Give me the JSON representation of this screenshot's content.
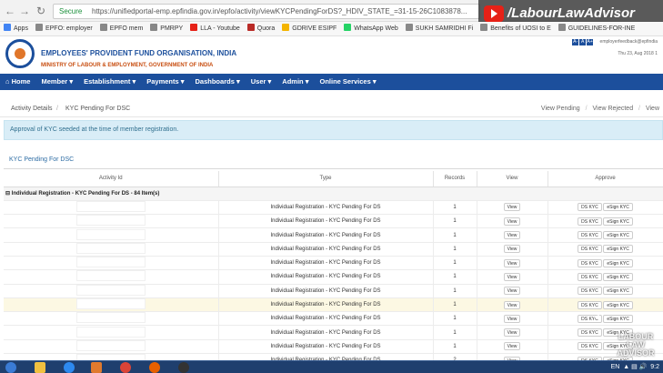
{
  "browser": {
    "secure_label": "Secure",
    "url": "https://unifiedportal-emp.epfindia.gov.in/epfo/activity/viewKYCPendingForDS?_HDIV_STATE_=31-15-26C1083878...",
    "bookmarks": [
      {
        "label": "Apps",
        "color": "#4285f4"
      },
      {
        "label": "EPFO: employer",
        "color": "#888888"
      },
      {
        "label": "EPFO mem",
        "color": "#888888"
      },
      {
        "label": "PMRPY",
        "color": "#888888"
      },
      {
        "label": "LLA - Youtube",
        "color": "#e62117"
      },
      {
        "label": "Quora",
        "color": "#b92b27"
      },
      {
        "label": "GDRIVE ESIPF",
        "color": "#f4b400"
      },
      {
        "label": "WhatsApp Web",
        "color": "#25d366"
      },
      {
        "label": "SUKH SAMRIDHI Fi",
        "color": "#888888"
      },
      {
        "label": "Benefits of UOSI to E",
        "color": "#888888"
      },
      {
        "label": "GUIDELINES-FOR-INE",
        "color": "#888888"
      }
    ]
  },
  "overlay": {
    "channel_title": "/LabourLawAdvisor",
    "watermark": "LABOUR LAW ADVISOR"
  },
  "header": {
    "org_name": "EMPLOYEES' PROVIDENT FUND ORGANISATION, INDIA",
    "ministry": "MINISTRY OF LABOUR & EMPLOYMENT, GOVERNMENT OF INDIA",
    "font_buttons": [
      "A-",
      "A",
      "A+"
    ],
    "feedback_email": "employerfeedback@epfindia",
    "date": "Thu 23, Aug 2018 1"
  },
  "nav": {
    "items": [
      "Home",
      "Member",
      "Establishment",
      "Payments",
      "Dashboards",
      "User",
      "Admin",
      "Online Services"
    ]
  },
  "breadcrumb": {
    "items": [
      "Activity Details",
      "KYC Pending For DSC"
    ],
    "actions": [
      "View Pending",
      "View Rejected",
      "View"
    ]
  },
  "alert": "Approval of KYC seeded at the time of member registration.",
  "panel_title": "KYC Pending For DSC",
  "table": {
    "headers": [
      "Activity Id",
      "Type",
      "Records",
      "View",
      "Approve"
    ],
    "group_label": "Individual Registration - KYC Pending For DS - 84 Item(s)",
    "view_label": "View",
    "ds_label": "DS KYC",
    "esign_label": "eSign KYC",
    "rows": [
      {
        "type": "Individual Registration - KYC Pending For DS",
        "records": "1"
      },
      {
        "type": "Individual Registration - KYC Pending For DS",
        "records": "1"
      },
      {
        "type": "Individual Registration - KYC Pending For DS",
        "records": "1"
      },
      {
        "type": "Individual Registration - KYC Pending For DS",
        "records": "1"
      },
      {
        "type": "Individual Registration - KYC Pending For DS",
        "records": "1"
      },
      {
        "type": "Individual Registration - KYC Pending For DS",
        "records": "1"
      },
      {
        "type": "Individual Registration - KYC Pending For DS",
        "records": "1"
      },
      {
        "type": "Individual Registration - KYC Pending For DS",
        "records": "1"
      },
      {
        "type": "Individual Registration - KYC Pending For DS",
        "records": "1"
      },
      {
        "type": "Individual Registration - KYC Pending For DS",
        "records": "1"
      },
      {
        "type": "Individual Registration - KYC Pending For DS",
        "records": "1"
      },
      {
        "type": "Individual Registration - KYC Pending For DS",
        "records": "2"
      }
    ],
    "highlighted_row": 7
  },
  "taskbar": {
    "lang": "EN",
    "time": "9:2"
  }
}
